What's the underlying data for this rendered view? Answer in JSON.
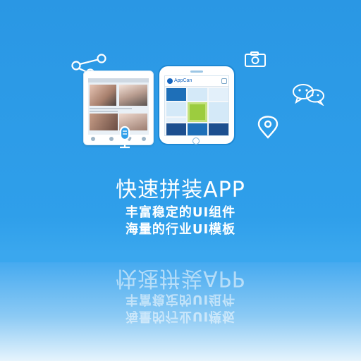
{
  "slogan": {
    "title": "快速拼装APP",
    "line1": "丰富稳定的UI组件",
    "line2": "海量的行业UI模板"
  },
  "phone": {
    "brand": "AppCan"
  },
  "icons": [
    "share-icon",
    "camera-icon",
    "wechat-icon",
    "location-pin-icon",
    "microphone-icon"
  ],
  "colors": {
    "background": "#2b9be6",
    "text": "#ffffff",
    "tile_blue": "#1e6fb8",
    "tile_light": "#d4e9f8",
    "tile_green": "#9ccc3f",
    "tile_navy": "#1d4f8f"
  }
}
